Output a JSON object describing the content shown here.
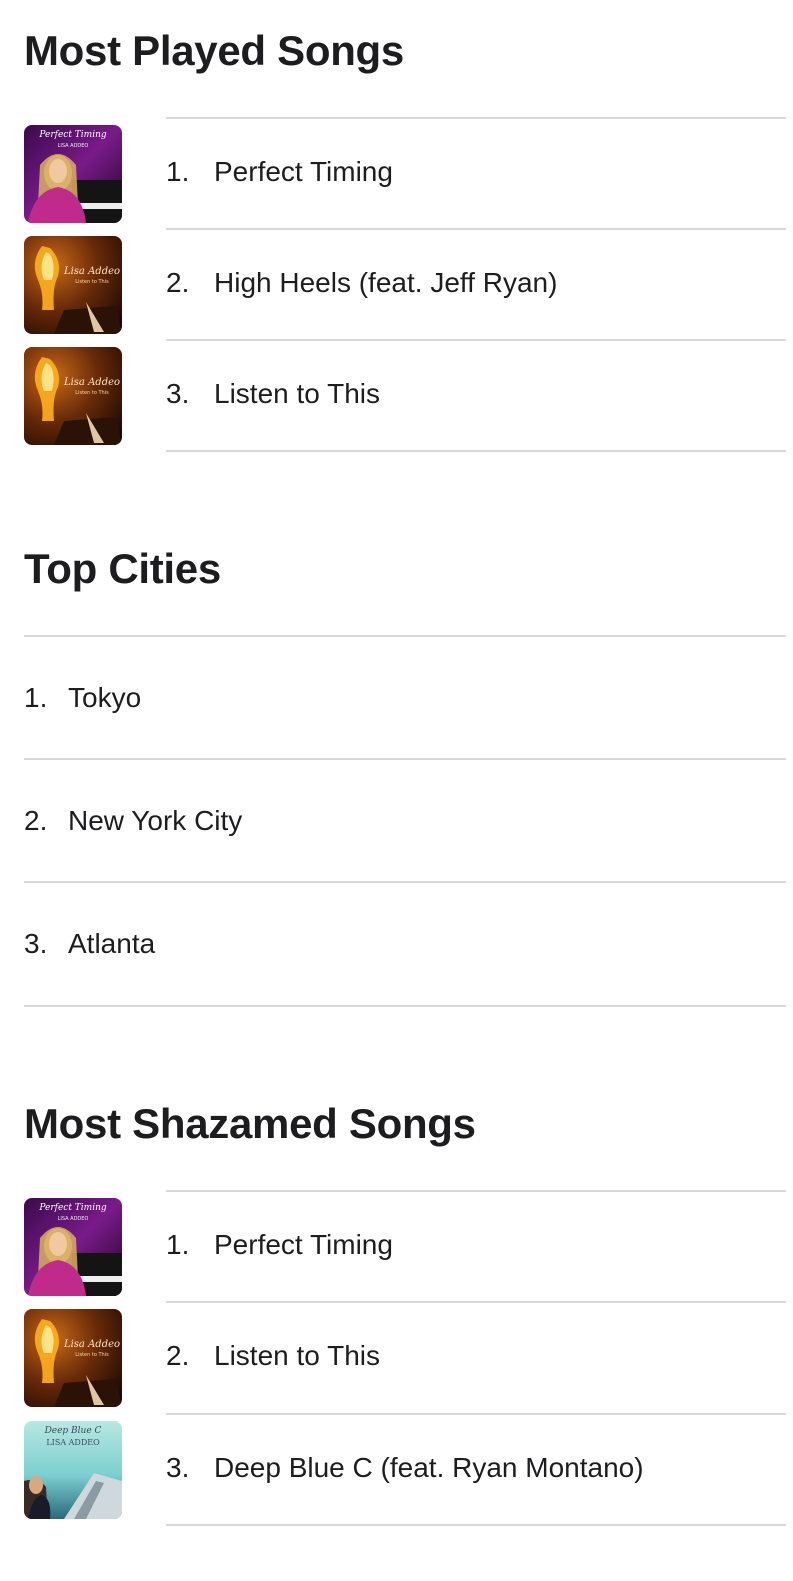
{
  "most_played": {
    "title": "Most Played Songs",
    "songs": [
      {
        "rank": "1.",
        "title": "Perfect Timing",
        "artwork": "perfect-timing-cover",
        "art_text": "Perfect Timing",
        "art_subtext": "LISA ADDEO"
      },
      {
        "rank": "2.",
        "title": "High Heels (feat. Jeff Ryan)",
        "artwork": "listen-to-this-cover",
        "art_text": "Lisa Addeo",
        "art_subtext": "Listen to This"
      },
      {
        "rank": "3.",
        "title": "Listen to This",
        "artwork": "listen-to-this-cover",
        "art_text": "Lisa Addeo",
        "art_subtext": "Listen to This"
      }
    ]
  },
  "top_cities": {
    "title": "Top Cities",
    "cities": [
      {
        "rank": "1.",
        "name": "Tokyo"
      },
      {
        "rank": "2.",
        "name": "New York City"
      },
      {
        "rank": "3.",
        "name": "Atlanta"
      }
    ]
  },
  "most_shazamed": {
    "title": "Most Shazamed Songs",
    "songs": [
      {
        "rank": "1.",
        "title": "Perfect Timing",
        "artwork": "perfect-timing-cover",
        "art_text": "Perfect Timing",
        "art_subtext": "LISA ADDEO"
      },
      {
        "rank": "2.",
        "title": "Listen to This",
        "artwork": "listen-to-this-cover",
        "art_text": "Lisa Addeo",
        "art_subtext": "Listen to This"
      },
      {
        "rank": "3.",
        "title": "Deep Blue C (feat. Ryan Montano)",
        "artwork": "deep-blue-c-cover",
        "art_text": "Deep Blue C",
        "art_subtext": "LISA ADDEO"
      }
    ]
  },
  "colors": {
    "text": "#1d1d1f",
    "divider": "#d9d9d9",
    "background": "#ffffff"
  }
}
